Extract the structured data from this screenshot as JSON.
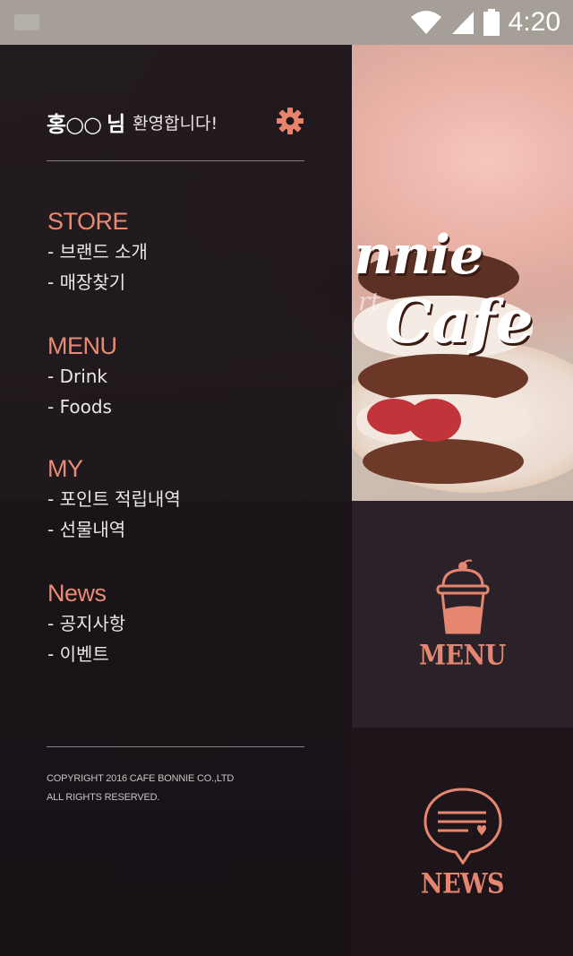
{
  "status_bar": {
    "time": "4:20",
    "icons": [
      "wifi-icon",
      "cellular-signal-icon",
      "battery-icon"
    ]
  },
  "drawer": {
    "user_name": "홍○○",
    "user_suffix": "님",
    "welcome": "환영합니다!",
    "sections": [
      {
        "title": "STORE",
        "items": [
          "- 브랜드 소개",
          "- 매장찾기"
        ]
      },
      {
        "title": "MENU",
        "items": [
          "- Drink",
          "- Foods"
        ]
      },
      {
        "title": "MY",
        "items": [
          "- 포인트 적립내역",
          "- 선물내역"
        ]
      },
      {
        "title": "News",
        "items": [
          "- 공지사항",
          "- 이벤트"
        ]
      }
    ],
    "copyright_line1": "COPYRIGHT 2016 CAFE BONNIE CO.,LTD",
    "copyright_line2": "ALL RIGHTS RESERVED."
  },
  "hero": {
    "logo_line1": "nnie",
    "logo_line2": "Cafe",
    "logo_partial": "rt"
  },
  "tiles": [
    {
      "label": "MENU",
      "icon": "drink-cup-icon"
    },
    {
      "label": "NEWS",
      "icon": "speech-bubble-heart-icon"
    }
  ],
  "colors": {
    "accent": "#ea8a73",
    "drawer_bg": "#1c151a",
    "tile_menu_bg": "#2b2229",
    "tile_news_bg": "#1d1519"
  }
}
